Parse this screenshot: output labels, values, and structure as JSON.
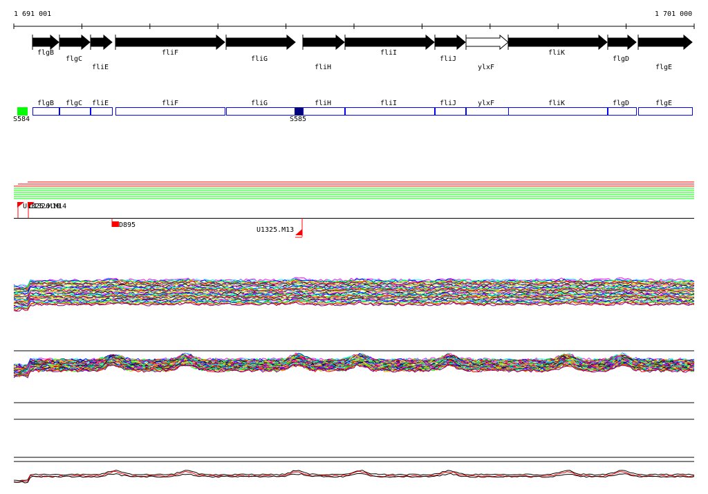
{
  "ruler": {
    "start_label": "1 691 001",
    "end_label": "1 701 000"
  },
  "genes": [
    {
      "name": "flgB",
      "row": 0,
      "fill": "#000000"
    },
    {
      "name": "flgC",
      "row": 1,
      "fill": "#000000"
    },
    {
      "name": "fliE",
      "row": 2,
      "fill": "#000000"
    },
    {
      "name": "fliF",
      "row": 0,
      "fill": "#000000"
    },
    {
      "name": "fliG",
      "row": 1,
      "fill": "#000000"
    },
    {
      "name": "fliH",
      "row": 2,
      "fill": "#000000"
    },
    {
      "name": "fliI",
      "row": 0,
      "fill": "#000000"
    },
    {
      "name": "fliJ",
      "row": 1,
      "fill": "#000000"
    },
    {
      "name": "ylxF",
      "row": 2,
      "fill": "#ffffff"
    },
    {
      "name": "fliK",
      "row": 0,
      "fill": "#000000"
    },
    {
      "name": "flgD",
      "row": 1,
      "fill": "#000000"
    },
    {
      "name": "flgE",
      "row": 2,
      "fill": "#000000"
    }
  ],
  "segments": [
    {
      "name": "S584",
      "color": "#00ff00"
    },
    {
      "name": "S585",
      "color": "#000080"
    }
  ],
  "markers": [
    {
      "name": "U1325.M10"
    },
    {
      "name": "U1326.M14"
    },
    {
      "name": "D895"
    },
    {
      "name": "U1325.M13"
    }
  ],
  "colors": {
    "box": "#0000ff",
    "marker": "#ff0000",
    "green": "#00ff00"
  }
}
